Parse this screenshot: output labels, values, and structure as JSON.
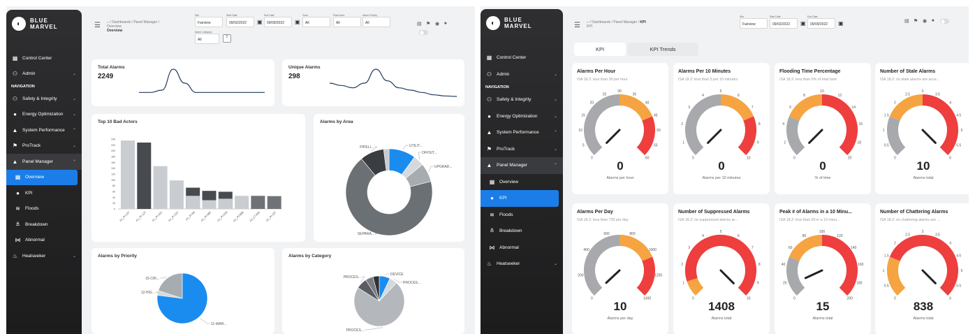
{
  "brand": {
    "name_line1": "BLUE",
    "name_line2": "MARVEL"
  },
  "nav": [
    {
      "id": "control",
      "label": "Control Center",
      "icon": "▦"
    },
    {
      "id": "admin",
      "label": "Admin",
      "icon": "⚇",
      "chev": "⌄"
    },
    {
      "id": "navhdr",
      "label": "NAVIGATION",
      "header": true
    },
    {
      "id": "safety",
      "label": "Safety & Integrity",
      "icon": "⚇",
      "chev": "⌄"
    },
    {
      "id": "energy",
      "label": "Energy Optimization",
      "icon": "●",
      "chev": "⌄"
    },
    {
      "id": "sysperf",
      "label": "System Performance",
      "icon": "▲",
      "chev": "⌃"
    },
    {
      "id": "protrack",
      "label": "ProTrack",
      "icon": "⚑",
      "chev": "⌄"
    },
    {
      "id": "panelmgr",
      "label": "Panel Manager",
      "icon": "▲",
      "chev": "⌃"
    },
    {
      "id": "overview",
      "label": "Overview",
      "icon": "▦",
      "sub": true
    },
    {
      "id": "kpi",
      "label": "KPI",
      "icon": "●",
      "sub": true
    },
    {
      "id": "floods",
      "label": "Floods",
      "icon": "≋",
      "sub": true
    },
    {
      "id": "breakdown",
      "label": "Breakdown",
      "icon": "≚",
      "sub": true
    },
    {
      "id": "abnormal",
      "label": "Abnormal",
      "icon": "⋈",
      "sub": true
    },
    {
      "id": "heatseeker",
      "label": "Heatseeker",
      "icon": "♨",
      "chev": "⌄"
    }
  ],
  "left": {
    "breadcrumb": "⌂ / Dashboards / Panel Manager /",
    "breadcrumb_page": "Overview",
    "title": "Overview",
    "filters": [
      {
        "label": "Site",
        "value": "Fairview"
      },
      {
        "label": "Start Date",
        "value": "09/02/2022"
      },
      {
        "label": "End Date",
        "value": "09/09/2022"
      },
      {
        "label": "Zone",
        "value": "All"
      },
      {
        "label": "Plant Area",
        "value": "All"
      },
      {
        "label": "Alarm Priority",
        "value": "All"
      },
      {
        "label": "Alarm Category",
        "value": "All"
      }
    ],
    "total_alarms": {
      "title": "Total Alarms",
      "value": "2249"
    },
    "unique_alarms": {
      "title": "Unique Alarms",
      "value": "298"
    },
    "bad_actors": {
      "title": "Top 10 Bad Actors"
    },
    "by_area": {
      "title": "Alarms by Area"
    },
    "by_priority": {
      "title": "Alarms by Priority"
    },
    "by_category": {
      "title": "Alarms by Category"
    }
  },
  "right": {
    "breadcrumb": "⌂ / Dashboards / Panel Manager /",
    "breadcrumb_page": "KPI",
    "title": "KPI",
    "filters": [
      {
        "label": "Site",
        "value": "Fairview"
      },
      {
        "label": "Start Date",
        "value": "09/02/2022"
      },
      {
        "label": "End Date",
        "value": "09/09/2022"
      }
    ],
    "tabs": [
      "KPI",
      "KPI Trends"
    ]
  },
  "chart_data": [
    {
      "type": "line",
      "title": "Total Alarms",
      "series": [
        {
          "values": [
            2,
            2,
            3,
            12,
            6,
            2,
            2,
            2,
            2,
            2,
            2,
            2
          ]
        }
      ]
    },
    {
      "type": "line",
      "title": "Unique Alarms",
      "series": [
        {
          "values": [
            6,
            5,
            4,
            6,
            12,
            7,
            4,
            3,
            2,
            1,
            0.5,
            0.3
          ]
        }
      ]
    },
    {
      "type": "bar",
      "title": "Top 10 Bad Actors",
      "categories": [
        "A1_PI-127",
        "A1_PI-127",
        "A1_PI-421",
        "A1_PI-237",
        "A1_PI-68",
        "A1_PI-682",
        "A1_PI-618",
        "A1_PC686",
        "A3_LT-655",
        "A1_PI-227"
      ],
      "values": [
        235,
        228,
        147,
        98,
        73,
        62,
        59,
        45,
        45,
        44
      ],
      "overlay": [
        0,
        0,
        0,
        0,
        45,
        30,
        35,
        0,
        0,
        0
      ],
      "yticks": [
        0,
        20,
        40,
        60,
        80,
        100,
        120,
        140,
        160,
        180,
        200,
        220,
        240
      ]
    },
    {
      "type": "pie",
      "title": "Alarms by Area",
      "donut": true,
      "slices": [
        {
          "label": "UTILIT...",
          "value": 10,
          "color": "#1a8cf0"
        },
        {
          "label": "OFFSIT...",
          "value": 4,
          "color": "#d6d9dc"
        },
        {
          "label": "UPGRAD...",
          "value": 7,
          "color": "#a7acb0"
        },
        {
          "label": "SEPARA...",
          "value": 68,
          "color": "#6b7075"
        },
        {
          "label": "PIPELI...",
          "value": 9,
          "color": "#3a3d41"
        },
        {
          "label": "",
          "value": 2,
          "color": "#c8cbcf"
        }
      ]
    },
    {
      "type": "pie",
      "title": "Alarms by Priority",
      "slices": [
        {
          "label": "11-WAR...",
          "value": 77,
          "color": "#1a8cf0"
        },
        {
          "label": "12-HIG...",
          "value": 3,
          "color": "#d6d9dc"
        },
        {
          "label": "15-CRI...",
          "value": 20,
          "color": "#a7acb0"
        }
      ]
    },
    {
      "type": "pie",
      "title": "Alarms by Category",
      "slices": [
        {
          "label": "DEVICE",
          "value": 7,
          "color": "#1a8cf0"
        },
        {
          "label": "PROCES...",
          "value": 5,
          "color": "#d6d9dc"
        },
        {
          "label": "PROCES...",
          "value": 72,
          "color": "#b4b8bc"
        },
        {
          "label": "PROCES...",
          "value": 7,
          "color": "#595d62"
        },
        {
          "label": "",
          "value": 5,
          "color": "#7a7e82"
        },
        {
          "label": "",
          "value": 4,
          "color": "#2d3034"
        }
      ]
    },
    {
      "type": "gauge",
      "title": "Alarms Per Hour",
      "subtitle": "ISA 18.2: less than 30 per hour",
      "min": 0,
      "max": 60,
      "ticks": [
        0,
        5,
        10,
        15,
        20,
        25,
        30,
        35,
        40,
        45,
        50,
        55,
        60
      ],
      "value": 0,
      "value_text": "0",
      "unit": "Alarms per hour"
    },
    {
      "type": "gauge",
      "title": "Alarms Per 10 Minutes",
      "subtitle": "ISA 18.2: less than 5 per 10 minutes",
      "min": 0,
      "max": 10,
      "ticks": [
        0,
        1,
        2,
        3,
        4,
        5,
        6,
        7,
        8,
        9,
        10
      ],
      "value": 0,
      "value_text": "0",
      "unit": "Alarms per 10 minutes"
    },
    {
      "type": "gauge",
      "title": "Flooding Time Percentage",
      "subtitle": "ISA 18.2: less than 5% of total time",
      "min": 0,
      "max": 20,
      "ticks": [
        0,
        2,
        4,
        6,
        8,
        10,
        12,
        14,
        16,
        18,
        20
      ],
      "value": 0,
      "value_text": "0",
      "unit": "% of time"
    },
    {
      "type": "gauge",
      "title": "Number of Stale Alarms",
      "subtitle": "ISA 18.2: no stale alarms are acce...",
      "min": 0,
      "max": 6,
      "ticks": [
        0,
        0.5,
        1,
        1.5,
        2,
        2.5,
        3,
        3.5,
        4,
        4.5,
        5,
        5.5,
        6
      ],
      "value": 10,
      "value_text": "10",
      "unit": "Alarms total"
    },
    {
      "type": "gauge",
      "title": "Alarms Per Day",
      "subtitle": "ISA 18.2: less than 720 per day",
      "min": 0,
      "max": 1400,
      "ticks": [
        0,
        200,
        400,
        600,
        800,
        1000,
        1200,
        1400
      ],
      "value": 10,
      "value_text": "10",
      "unit": "Alarms per day"
    },
    {
      "type": "gauge",
      "title": "Number of Suppressed Alarms",
      "subtitle": "ISA 18.2: no suppressed alarms ar...",
      "min": 0,
      "max": 10,
      "ticks": [
        0,
        1,
        2,
        3,
        4,
        5,
        6,
        7,
        8,
        9,
        10
      ],
      "value": 1408,
      "value_text": "1408",
      "unit": "Alarms total"
    },
    {
      "type": "gauge",
      "title": "Peak # of Alarms in a 10 Minu...",
      "subtitle": "ISA 18.2: less than 50 in a 10 minu...",
      "min": 0,
      "max": 200,
      "ticks": [
        0,
        20,
        40,
        60,
        80,
        100,
        120,
        140,
        160,
        180,
        200
      ],
      "value": 15,
      "value_text": "15",
      "unit": "Alarms total"
    },
    {
      "type": "gauge",
      "title": "Number of Chattering Alarms",
      "subtitle": "ISA 18.2: no chattering alarms are ...",
      "min": 0,
      "max": 6,
      "ticks": [
        0,
        0.5,
        1,
        1.5,
        2,
        2.5,
        3,
        3.5,
        4,
        4.5,
        5,
        5.5,
        6
      ],
      "value": 838,
      "value_text": "838",
      "unit": "Alarms total"
    }
  ]
}
